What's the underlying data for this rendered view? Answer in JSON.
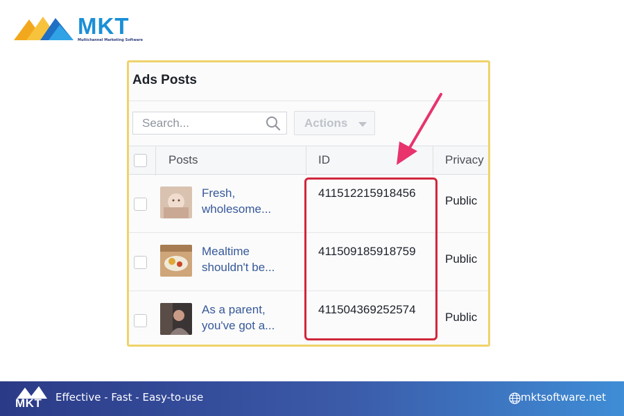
{
  "brand": {
    "name": "MKT",
    "tagline": "Multichannel Marketing Software"
  },
  "panel": {
    "title": "Ads Posts",
    "search": {
      "placeholder": "Search..."
    },
    "actions_label": "Actions",
    "columns": [
      "Posts",
      "ID",
      "Privacy"
    ],
    "rows": [
      {
        "post": [
          "Fresh,",
          "wholesome..."
        ],
        "id": "411512215918456",
        "privacy": "Public"
      },
      {
        "post": [
          "Mealtime",
          "shouldn't be..."
        ],
        "id": "411509185918759",
        "privacy": "Public"
      },
      {
        "post": [
          "As a parent,",
          "you've got a..."
        ],
        "id": "411504369252574",
        "privacy": "Public"
      }
    ]
  },
  "footer": {
    "slogan": "Effective - Fast - Easy-to-use",
    "website": "mktsoftware.net"
  },
  "colors": {
    "brand_blue": "#1a8fd6",
    "link_blue": "#365899",
    "highlight_red": "#d0263b",
    "arrow_pink": "#e8336d",
    "panel_border": "#efd36a"
  }
}
